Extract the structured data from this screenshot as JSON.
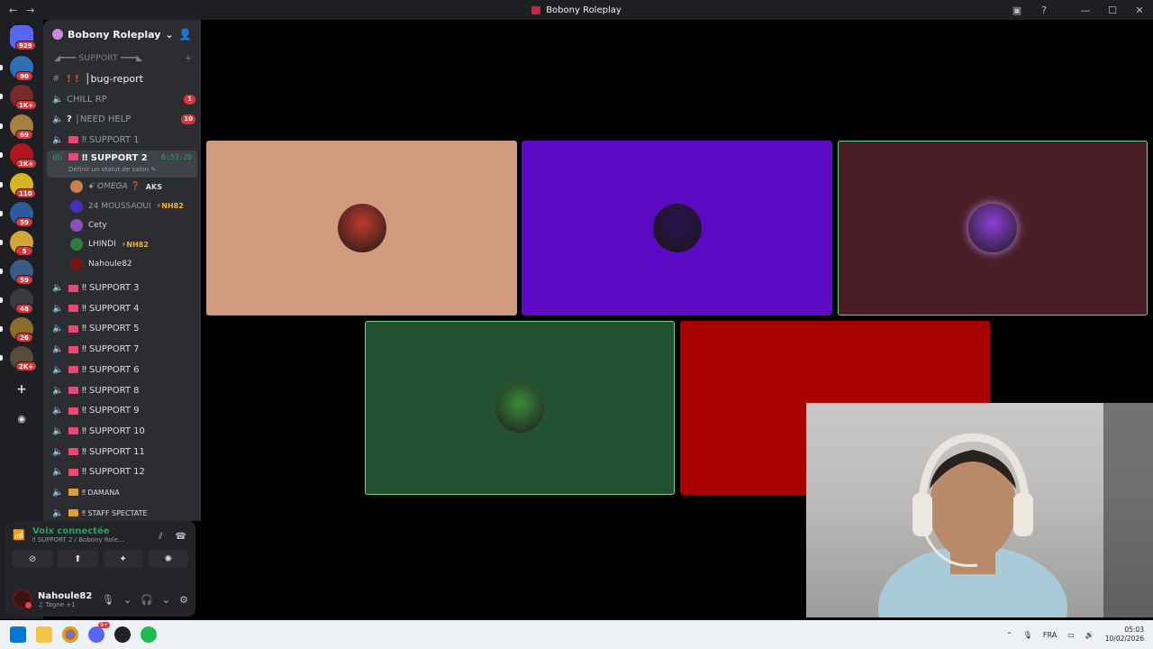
{
  "window": {
    "title": "Bobony Roleplay",
    "back": "←",
    "forward": "→",
    "controls": [
      "▣",
      "?",
      "—",
      "☐",
      "✕"
    ]
  },
  "rail": {
    "servers": [
      {
        "name": "direct-messages",
        "badge": "929",
        "color": "#5865f2"
      },
      {
        "name": "server-1",
        "badge": "90",
        "color": "#2f6fb6"
      },
      {
        "name": "server-2",
        "badge": "1K+",
        "color": "#7a2a2a"
      },
      {
        "name": "server-3",
        "badge": "69",
        "color": "#a8823c"
      },
      {
        "name": "server-4",
        "badge": "1K+",
        "color": "#b2151d"
      },
      {
        "name": "server-5",
        "badge": "110",
        "color": "#d8b322"
      },
      {
        "name": "server-6",
        "badge": "59",
        "color": "#2b5b9c"
      },
      {
        "name": "server-7",
        "badge": "5",
        "color": "#d4a63a"
      },
      {
        "name": "server-8",
        "badge": "59",
        "color": "#3a5a8a"
      },
      {
        "name": "server-9",
        "badge": "48",
        "color": "#3b3b3b"
      },
      {
        "name": "server-10",
        "badge": "26",
        "color": "#8a6d2a"
      },
      {
        "name": "server-11",
        "badge": "2K+",
        "color": "#5a4a3a"
      }
    ],
    "add_label": "+",
    "discover_label": "◉"
  },
  "sidebar": {
    "server_name": "Bobony Roleplay",
    "category": "◢━━━ SUPPORT ━━━◣",
    "category_add": "+",
    "channels": [
      {
        "type": "text",
        "name": "│bug-report"
      },
      {
        "type": "voice",
        "name": "CHILL RP",
        "badge": "1"
      },
      {
        "type": "voice",
        "name": "│NEED HELP",
        "badge": "10",
        "prefix": "?"
      },
      {
        "type": "voice",
        "name": "‼ SUPPORT 1"
      },
      {
        "type": "voice-active",
        "name": "‼ SUPPORT 2",
        "timer": "6:53:20",
        "status": "Définir un statut de salon ✎"
      }
    ],
    "members": [
      {
        "name": "ꗃ 𝘖𝘔𝘌𝘎𝘈 ❓",
        "tag": "AKS",
        "color": "#c7824b",
        "dim": true
      },
      {
        "name": "24 MOUSSAOUI",
        "tag": "⚡NH82",
        "color": "#4b2dbf",
        "dim": true
      },
      {
        "name": "Cety",
        "tag": "",
        "color": "#8a4fb8",
        "dim": false
      },
      {
        "name": "LHINDI",
        "tag": "⚡NH82",
        "color": "#2f7d3c",
        "dim": false
      },
      {
        "name": "Nahoule82",
        "tag": "",
        "color": "#7a1313",
        "dim": false
      }
    ],
    "channels_after": [
      {
        "name": "‼ SUPPORT 3"
      },
      {
        "name": "‼ SUPPORT 4"
      },
      {
        "name": "‼ SUPPORT 5"
      },
      {
        "name": "‼ SUPPORT 7"
      },
      {
        "name": "‼ SUPPORT 6"
      },
      {
        "name": "‼ SUPPORT 8"
      },
      {
        "name": "‼ SUPPORT 9"
      },
      {
        "name": "‼ SUPPORT 10"
      },
      {
        "name": "‼ SUPPORT 11"
      },
      {
        "name": "‼ SUPPORT 12"
      },
      {
        "name": "‼ DAMANA"
      },
      {
        "name": "‼ STAFF SPECTATE"
      }
    ]
  },
  "voice_panel": {
    "title": "Voix connectée",
    "subtitle": "‼ SUPPORT 2 / Bobony Role...",
    "buttons": [
      "⊘",
      "⬆",
      "✦",
      "✺"
    ]
  },
  "user": {
    "name": "Nahoule82",
    "status": "♫ Tagne +1"
  },
  "tiles": [
    {
      "name": "tile-omega",
      "bg": "#d09a7c",
      "avatar": "#c0392b",
      "speaking": false
    },
    {
      "name": "tile-moussaoui",
      "bg": "#5d0ac4",
      "avatar": "#2a1050",
      "speaking": false
    },
    {
      "name": "tile-cety",
      "bg": "#4a1e26",
      "avatar": "#8e3fd6",
      "speaking": true
    },
    {
      "name": "tile-lhindi",
      "bg": "#245131",
      "avatar": "#3a8a3a",
      "speaking": true
    },
    {
      "name": "tile-nahoule",
      "bg": "#a80101",
      "avatar": "#a80101",
      "speaking": false
    }
  ],
  "taskbar": {
    "lang": "FRA",
    "time": "05:03",
    "date": "10/02/2026",
    "discord_badge": "9+"
  },
  "colors": {
    "discord_bg": "#2b2d31",
    "rail_bg": "#1e1f22",
    "accent_red": "#da373c",
    "voice_green": "#23a55a"
  }
}
